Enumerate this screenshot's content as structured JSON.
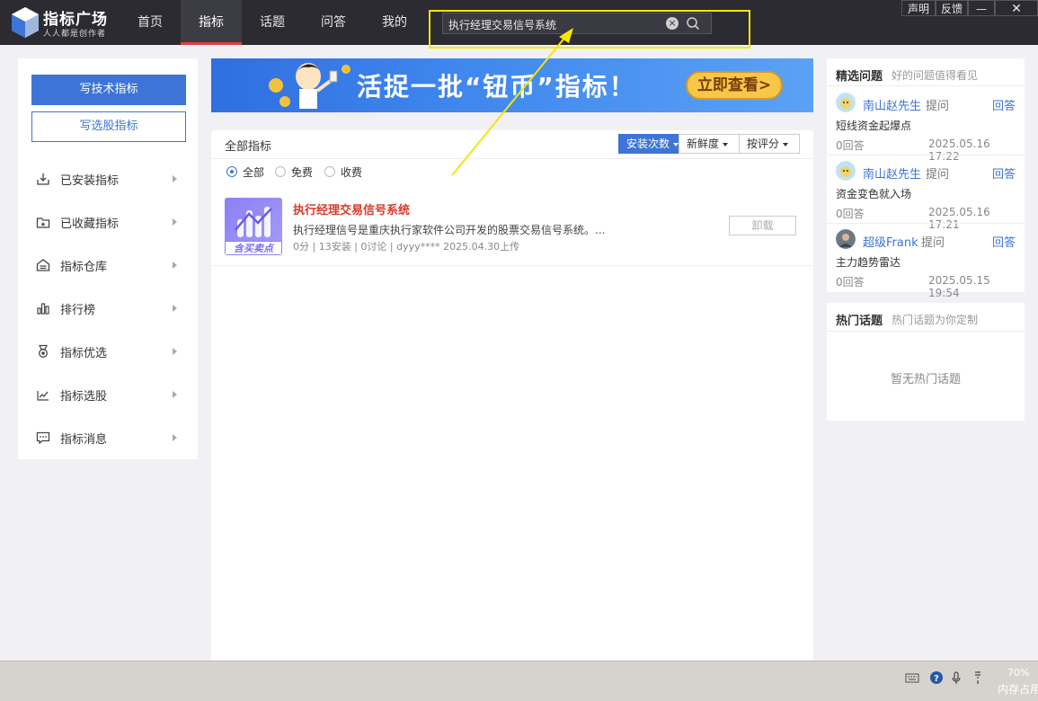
{
  "app": {
    "logo_title": "指标广场",
    "logo_subtitle": "人人都是创作者"
  },
  "nav": [
    "首页",
    "指标",
    "话题",
    "问答",
    "我的"
  ],
  "nav_active": "指标",
  "search": {
    "value": "执行经理交易信号系统",
    "clear_glyph": "×"
  },
  "window_buttons": {
    "statement": "声明",
    "feedback": "反馈",
    "minimize": "—",
    "close": "✕"
  },
  "left_panel": {
    "write_tech": "写技术指标",
    "write_stock": "写选股指标",
    "items": [
      {
        "label": "已安装指标",
        "icon": "download-box-icon"
      },
      {
        "label": "已收藏指标",
        "icon": "folder-star-icon"
      },
      {
        "label": "指标仓库",
        "icon": "warehouse-icon"
      },
      {
        "label": "排行榜",
        "icon": "bar-chart-icon"
      },
      {
        "label": "指标优选",
        "icon": "medal-icon"
      },
      {
        "label": "指标选股",
        "icon": "trend-icon"
      },
      {
        "label": "指标消息",
        "icon": "message-icon"
      }
    ]
  },
  "banner": {
    "text": "活捉一批“钮币”指标！",
    "cta": "立即查看>"
  },
  "main": {
    "title": "全部指标",
    "sort_options": [
      "安装次数",
      "新鲜度",
      "按评分"
    ],
    "sort_active": "安装次数",
    "filters": [
      "全部",
      "免费",
      "收费"
    ],
    "filter_active": "全部",
    "item": {
      "badge": "含买卖点",
      "title": "执行经理交易信号系统",
      "description": "执行经理信号是重庆执行家软件公司开发的股票交易信号系统。...",
      "meta": "0分 | 13安装 | 0讨论 |   dyyy****  2025.04.30上传",
      "action": "卸载"
    }
  },
  "featured_questions": {
    "title": "精选问题",
    "subtitle": "好的问题值得看见",
    "ask_label": "提问",
    "answer_label": "回答",
    "questions": [
      {
        "user": "南山赵先生",
        "text": "短线资金起爆点",
        "answers": "0回答",
        "time": "2025.05.16 17:22"
      },
      {
        "user": "南山赵先生",
        "text": "资金变色就入场",
        "answers": "0回答",
        "time": "2025.05.16 17:21"
      },
      {
        "user": "超级Frank",
        "text": "主力趋势雷达",
        "answers": "0回答",
        "time": "2025.05.15 19:54"
      }
    ]
  },
  "hot_topics": {
    "title": "热门话题",
    "subtitle": "热门话题为你定制",
    "empty": "暂无热门话题"
  },
  "statusbar": {
    "memory_percent": "70%",
    "memory_label": "内存占用"
  },
  "colors": {
    "accent": "#3d74d6",
    "title_red": "#d93a2b",
    "highlight_yellow": "#f2e800",
    "topbar": "#2b2b31"
  }
}
